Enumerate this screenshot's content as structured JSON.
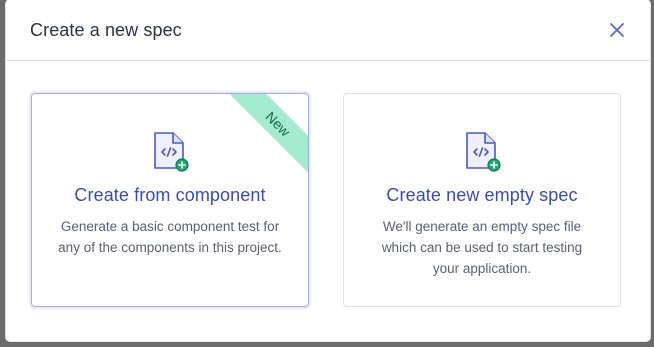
{
  "dialog": {
    "title": "Create a new spec",
    "close_icon": "close-icon"
  },
  "cards": [
    {
      "title": "Create from component",
      "description": "Generate a basic component test for any of the components in this project.",
      "badge": "New",
      "icon": "file-code-add-icon",
      "selected": true
    },
    {
      "title": "Create new empty spec",
      "description": "We'll generate an empty spec file which can be used to start testing your application.",
      "icon": "file-code-add-icon",
      "selected": false
    }
  ],
  "colors": {
    "accent": "#3b49c1",
    "badge_bg": "#a4ebd0",
    "badge_text": "#0f6c4a",
    "plus_green": "#1fa971"
  }
}
